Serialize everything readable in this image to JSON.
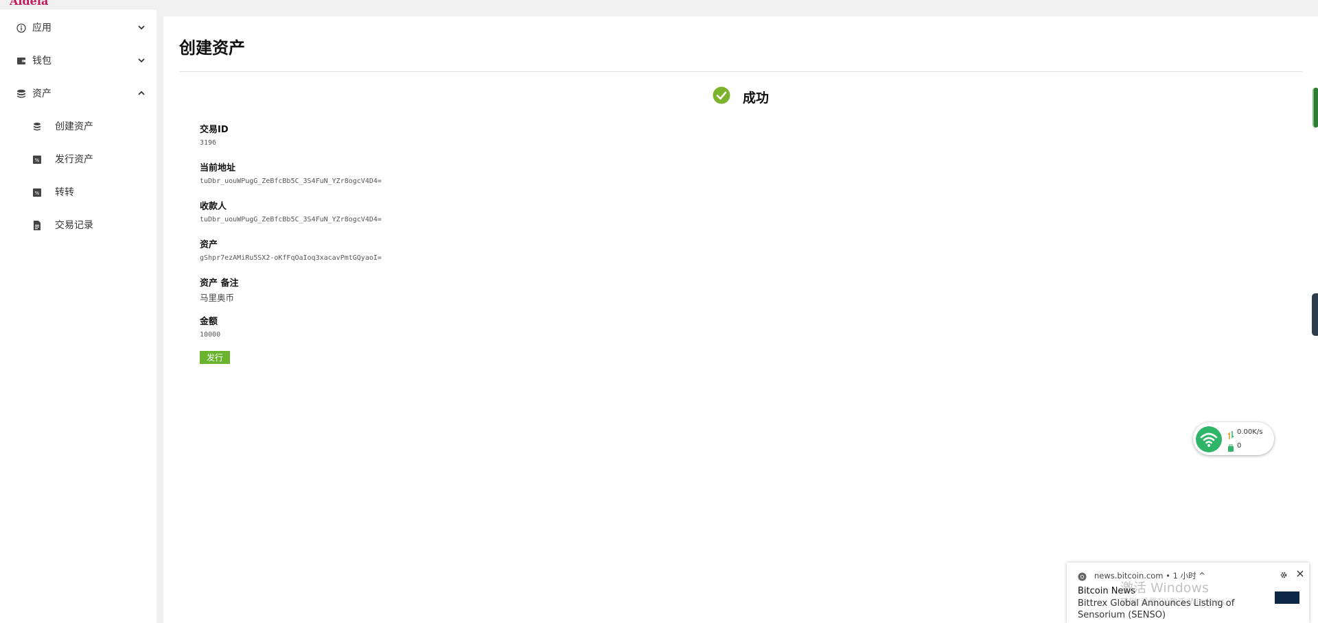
{
  "app": {
    "logo_text": "Aldeia"
  },
  "sidebar": {
    "items": [
      {
        "label": "应用",
        "icon": "info-circle-icon"
      },
      {
        "label": "钱包",
        "icon": "wallet-icon"
      },
      {
        "label": "资产",
        "icon": "database-icon"
      }
    ],
    "subitems": [
      {
        "label": "创建资产",
        "icon": "database-icon"
      },
      {
        "label": "发行资产",
        "icon": "percent-badge-icon"
      },
      {
        "label": "转转",
        "icon": "percent-badge-icon"
      },
      {
        "label": "交易记录",
        "icon": "document-icon"
      }
    ]
  },
  "page": {
    "title": "创建资产",
    "status_text": "成功",
    "status_color": "#7cb32c",
    "fields": [
      {
        "label": "交易ID",
        "value": "3196"
      },
      {
        "label": "当前地址",
        "value": "tuDbr_uouWPugG_ZeBfcBb5C_3S4FuN_YZr8ogcV4D4="
      },
      {
        "label": "收款人",
        "value": "tuDbr_uouWPugG_ZeBfcBb5C_3S4FuN_YZr8ogcV4D4="
      },
      {
        "label": "资产",
        "value": "gShpr7ezAMiRu5SX2-oKfFqOaIoq3xacavPmtGQyaoI="
      },
      {
        "label": "资产 备注",
        "value": "马里奥币"
      },
      {
        "label": "金额",
        "value": "10000"
      }
    ],
    "issue_button": "发行",
    "accent_color": "#69b32d"
  },
  "network_widget": {
    "speed": "0.00K/s",
    "count": "0"
  },
  "notification": {
    "source": "news.bitcoin.com",
    "time": "1 小时",
    "title": "Bitcoin News",
    "body": "Bittrex Global Announces Listing of Sensorium (SENSO)"
  },
  "watermark": {
    "line1": "激活 Windows",
    "line2": "转到\"设置\"以激活 Windows。"
  }
}
